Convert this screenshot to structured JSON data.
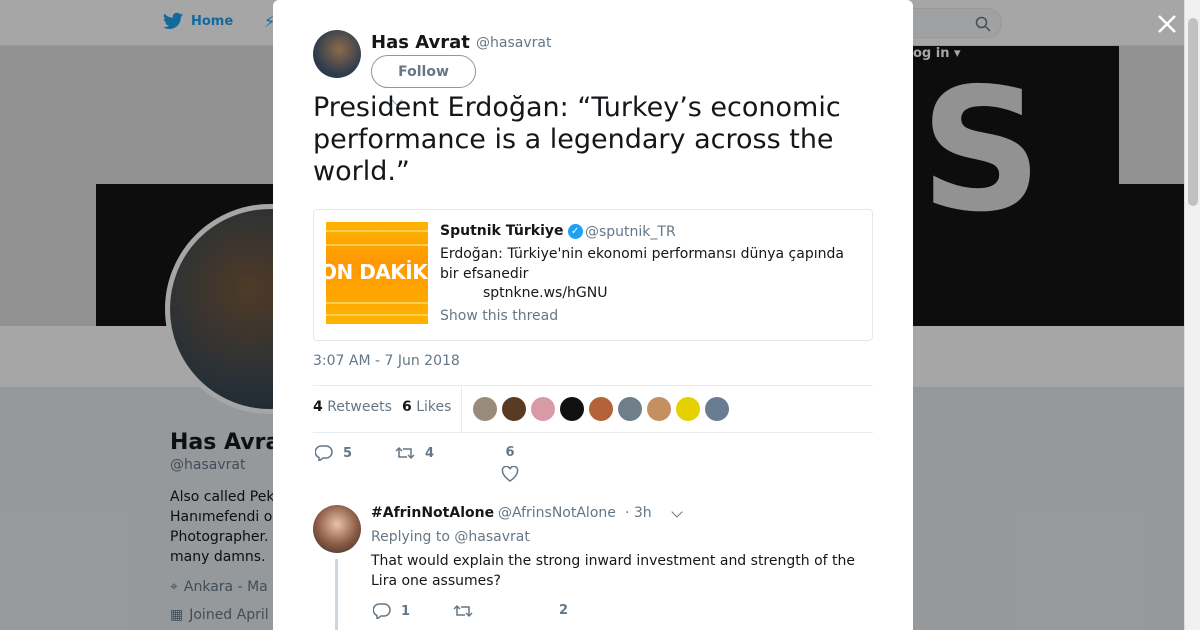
{
  "topnav": {
    "home_label": "Home",
    "login_label": "og in ▾"
  },
  "profile": {
    "name": "Has Avra",
    "handle": "@hasavrat",
    "bio": "Also called Pek\nHanımefendi o\nPhotographer.\nmany damns.",
    "location": "Ankara - Ma",
    "joined": "Joined April"
  },
  "tweet": {
    "author_name": "Has Avrat",
    "author_handle": "@hasavrat",
    "follow_label": "Follow",
    "text": "President Erdoğan: “Turkey’s economic performance is a legendary across the world.”",
    "timestamp": "3:07 AM - 7 Jun 2018",
    "retweets_count": "4",
    "retweets_label": "Retweets",
    "likes_count": "6",
    "likes_label": "Likes",
    "reply_count": "5",
    "retweet_count": "4",
    "like_count": "6"
  },
  "quote": {
    "image_text": "ON DAKİK",
    "name": "Sputnik Türkiye",
    "handle": "@sputnik_TR",
    "text": "Erdoğan: Türkiye'nin ekonomi performansı dünya çapında bir efsanedir",
    "link": "sptnkne.ws/hGNU",
    "show_thread": "Show this thread"
  },
  "likers": [
    {
      "color": "#9a8a7c"
    },
    {
      "color": "#5a3b22"
    },
    {
      "color": "#d99aa8"
    },
    {
      "color": "#111111"
    },
    {
      "color": "#b5623a"
    },
    {
      "color": "#6f7f8a"
    },
    {
      "color": "#c49060"
    },
    {
      "color": "#e5d000"
    },
    {
      "color": "#6a7c92"
    }
  ],
  "reply": {
    "name": "#AfrinNotAlone",
    "handle": "@AfrinsNotAlone",
    "time": "· 3h",
    "replying_prefix": "Replying to",
    "replying_to": "@hasavrat",
    "text": "That would explain the strong inward investment and strength of the Lira one assumes?",
    "reply_count": "1",
    "retweet_count": "",
    "like_count": "2"
  },
  "colors": {
    "twitter_blue": "#1da1f2",
    "gray": "#657786",
    "overlay": "rgba(0,0,0,0.35)"
  }
}
